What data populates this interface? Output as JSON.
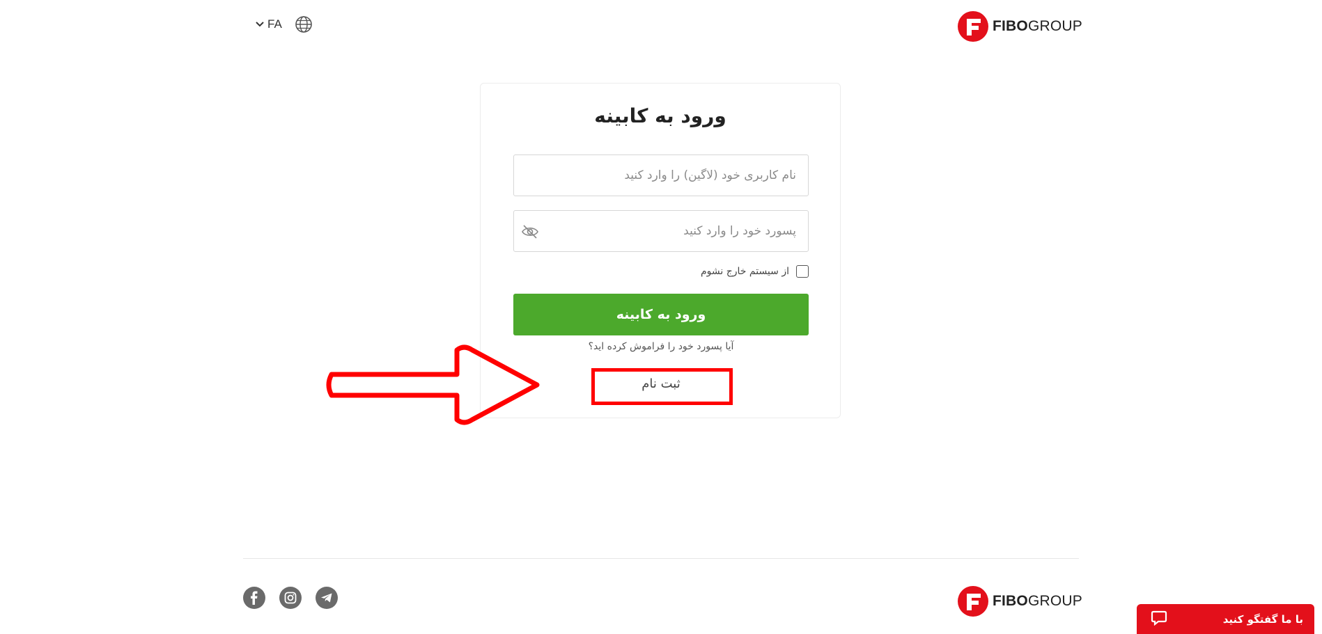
{
  "header": {
    "language_code": "FA",
    "logo_text_bold": "FIBO",
    "logo_text_regular": "GROUP"
  },
  "login_card": {
    "title": "ورود به کابینه",
    "username_placeholder": "نام کاربری خود (لاگین) را وارد کنید",
    "password_placeholder": "پسورد خود را وارد کنید",
    "remember_label": "از سیستم خارج نشوم",
    "submit_label": "ورود به کابینه",
    "forgot_password": "آیا پسورد خود را فراموش کرده اید؟",
    "register_label": "ثبت نام"
  },
  "footer": {
    "logo_text_bold": "FIBO",
    "logo_text_regular": "GROUP",
    "socials": [
      "facebook-icon",
      "instagram-icon",
      "telegram-icon"
    ]
  },
  "chat": {
    "label": "با ما گفتگو کنید"
  },
  "colors": {
    "brand_red": "#e3101b",
    "submit_green": "#4ca92c",
    "annotation_red": "#ff0000"
  }
}
